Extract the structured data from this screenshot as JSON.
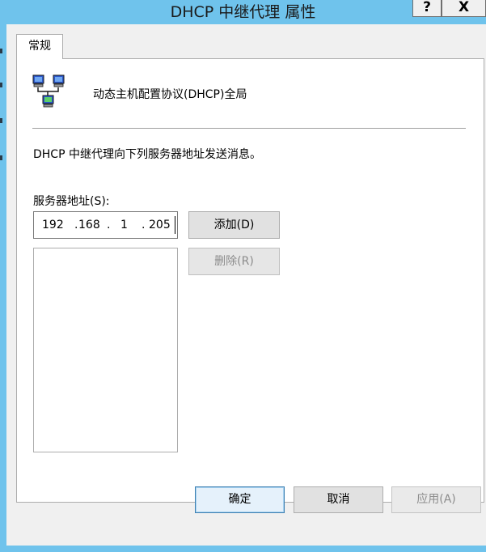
{
  "window": {
    "title": "DHCP 中继代理 属性",
    "help_label": "?",
    "close_label": "X",
    "frame_color": "#6fc3ec"
  },
  "tabs": [
    {
      "label": "常规",
      "selected": true
    }
  ],
  "general": {
    "header_icon": "network-computers-icon",
    "header_text": "动态主机配置协议(DHCP)全局",
    "description": "DHCP 中继代理向下列服务器地址发送消息。",
    "server_address_label": "服务器地址(S):",
    "ip": {
      "octet1": "192",
      "octet2": "168",
      "octet3": "1",
      "octet4": "205",
      "sep": "."
    },
    "server_list": [],
    "add_button": "添加(D)",
    "remove_button": "删除(R)"
  },
  "footer": {
    "ok_button": "确定",
    "cancel_button": "取消",
    "apply_button": "应用(A)"
  }
}
